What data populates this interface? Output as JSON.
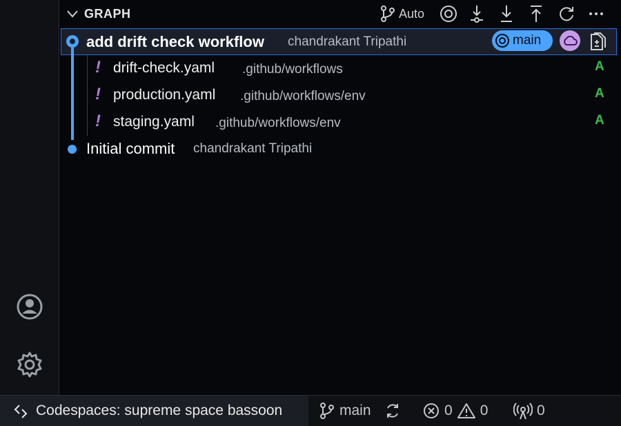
{
  "panel": {
    "title": "GRAPH",
    "toolbar": {
      "auto_label": "Auto"
    }
  },
  "commits": [
    {
      "message": "add drift check workflow",
      "author": "chandrakant Tripathi",
      "branch": "main",
      "selected": true
    },
    {
      "message": "Initial commit",
      "author": "chandrakant Tripathi",
      "selected": false
    }
  ],
  "files": [
    {
      "name": "drift-check.yaml",
      "path": ".github/workflows",
      "status": "A"
    },
    {
      "name": "production.yaml",
      "path": ".github/workflows/env",
      "status": "A"
    },
    {
      "name": "staging.yaml",
      "path": ".github/workflows/env",
      "status": "A"
    }
  ],
  "statusbar": {
    "remote": "Codespaces: supreme space bassoon",
    "branch": "main",
    "errors": "0",
    "warnings": "0",
    "ports": "0"
  },
  "colors": {
    "accent": "#4ba3ff",
    "added": "#3fb950",
    "modified_bang": "#b57bd6",
    "cloud_badge": "#c79be8"
  }
}
